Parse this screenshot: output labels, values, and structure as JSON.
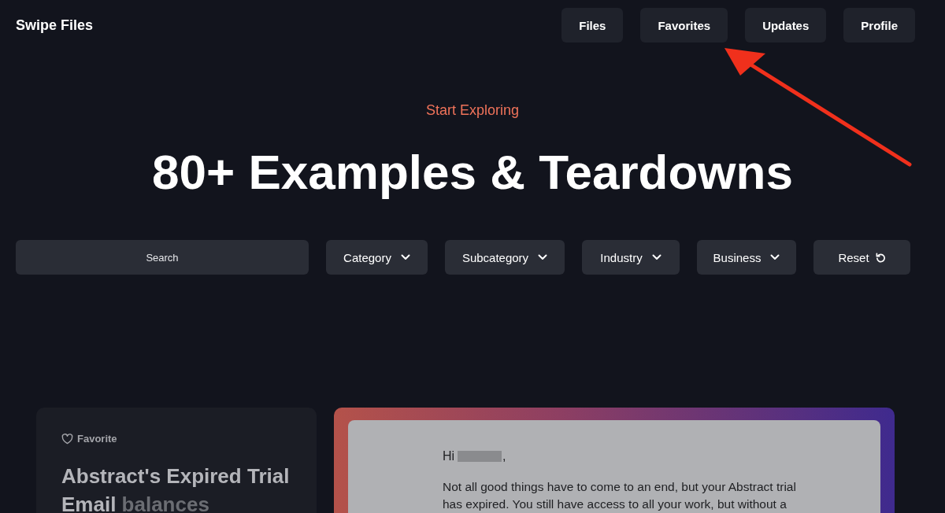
{
  "site": {
    "title": "Swipe Files"
  },
  "nav": [
    {
      "label": "Files"
    },
    {
      "label": "Favorites"
    },
    {
      "label": "Updates"
    },
    {
      "label": "Profile"
    }
  ],
  "hero": {
    "eyebrow": "Start Exploring",
    "heading": "80+ Examples & Teardowns"
  },
  "filters": {
    "search": {
      "placeholder": "Search"
    },
    "dropdowns": [
      {
        "label": "Category"
      },
      {
        "label": "Subcategory"
      },
      {
        "label": "Industry"
      },
      {
        "label": "Business"
      }
    ],
    "reset": "Reset"
  },
  "card": {
    "favorite": {
      "label": "Favorite",
      "selected": false
    },
    "title": "Abstract's Expired Trial Email",
    "title_faded": "balances"
  },
  "email_preview": {
    "greeting": "Hi",
    "greeting_end": ",",
    "lines": [
      "Not all good things have to come to an end, but your Abstract trial",
      "has expired. You still have access to all your work, but without a"
    ]
  }
}
